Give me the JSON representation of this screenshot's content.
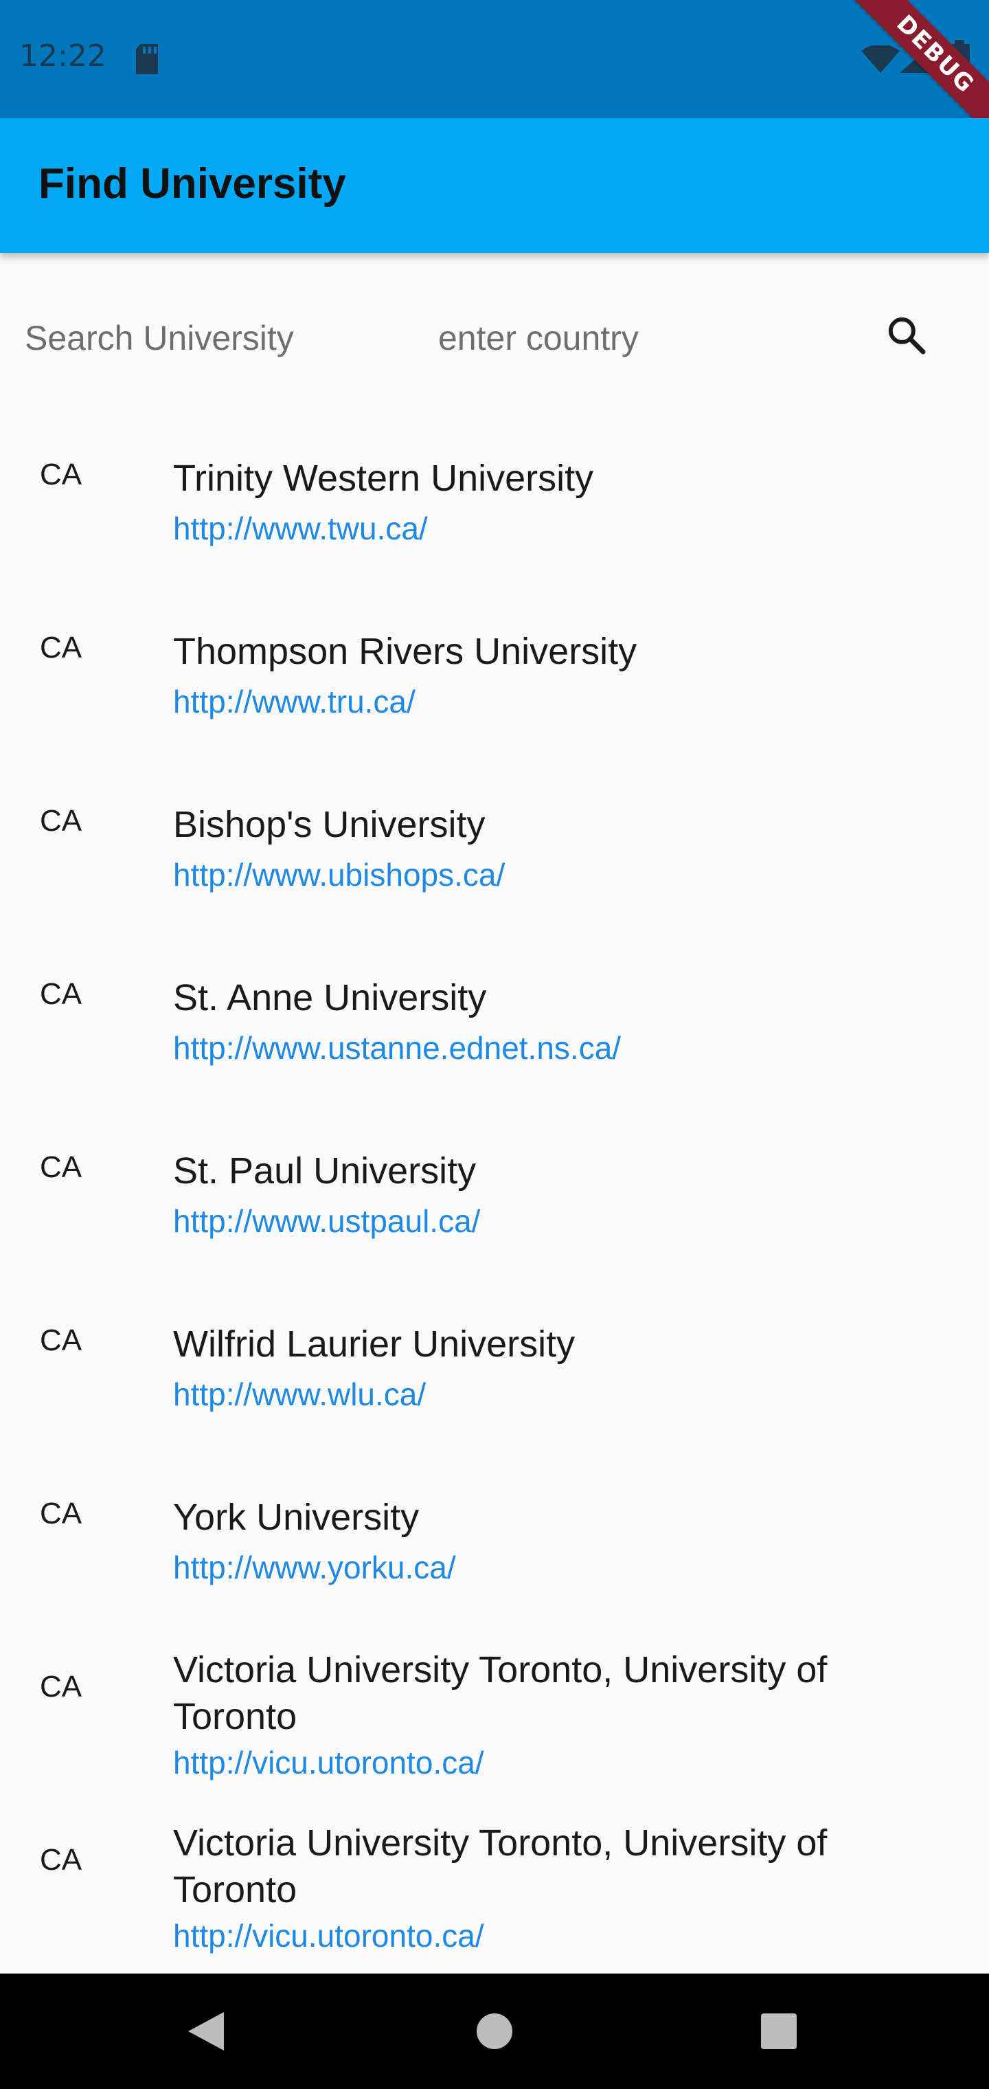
{
  "status_bar": {
    "time": "12:22",
    "debug_label": "DEBUG"
  },
  "app_bar": {
    "title": "Find University"
  },
  "search": {
    "university_placeholder": "Search University",
    "country_placeholder": "enter country"
  },
  "universities": [
    {
      "country": "CA",
      "name": "Trinity Western University",
      "url": "http://www.twu.ca/"
    },
    {
      "country": "CA",
      "name": "Thompson Rivers University",
      "url": "http://www.tru.ca/"
    },
    {
      "country": "CA",
      "name": "Bishop's University",
      "url": "http://www.ubishops.ca/"
    },
    {
      "country": "CA",
      "name": "St. Anne University",
      "url": "http://www.ustanne.ednet.ns.ca/"
    },
    {
      "country": "CA",
      "name": "St. Paul University",
      "url": "http://www.ustpaul.ca/"
    },
    {
      "country": "CA",
      "name": "Wilfrid Laurier University",
      "url": "http://www.wlu.ca/"
    },
    {
      "country": "CA",
      "name": "York University",
      "url": "http://www.yorku.ca/"
    },
    {
      "country": "CA",
      "name": "Victoria University Toronto, University of Toronto",
      "url": "http://vicu.utoronto.ca/"
    },
    {
      "country": "CA",
      "name": "Victoria University Toronto, University of Toronto",
      "url": "http://vicu.utoronto.ca/"
    }
  ],
  "colors": {
    "status_bar": "#0277bd",
    "app_bar": "#03a9f4",
    "link": "#1e88e5",
    "debug_banner": "#8a1c2e"
  }
}
